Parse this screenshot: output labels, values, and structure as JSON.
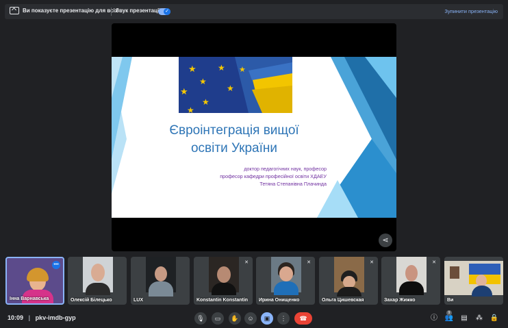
{
  "topbar": {
    "presenting_text": "Ви показуєте презентацію для всіх",
    "sound_label": "Звук презентації",
    "stop_label": "Зупинити презентацію"
  },
  "slide": {
    "title_line1": "Євроінтеграція вищої",
    "title_line2": "освіти України",
    "subtitle_lines": [
      "доктор педагогічних наук, професор",
      "професор кафедри професійної освіти ХДАЕУ",
      "Тетяна Степанівна Плачинда"
    ]
  },
  "participants": [
    {
      "name": "Інна Варнавська",
      "muted": false,
      "more": "•••"
    },
    {
      "name": "Олексій Білецько",
      "muted": false
    },
    {
      "name": "LUX",
      "muted": false
    },
    {
      "name": "Konstantin Konstantin",
      "muted": true
    },
    {
      "name": "Ирина Онищенко",
      "muted": true
    },
    {
      "name": "Ольга Цишевская",
      "muted": true
    },
    {
      "name": "Захар Жижко",
      "muted": true
    },
    {
      "name": "Ви",
      "muted": false
    }
  ],
  "bottombar": {
    "time": "10:09",
    "separator": "|",
    "meeting_code": "pkv-imdb-gyp",
    "people_count": "9"
  },
  "colors": {
    "background": "#202124",
    "accent_blue": "#8ab4f8",
    "end_call_red": "#ea4335",
    "slide_title": "#2e75b6",
    "slide_subtitle": "#7030a0"
  }
}
